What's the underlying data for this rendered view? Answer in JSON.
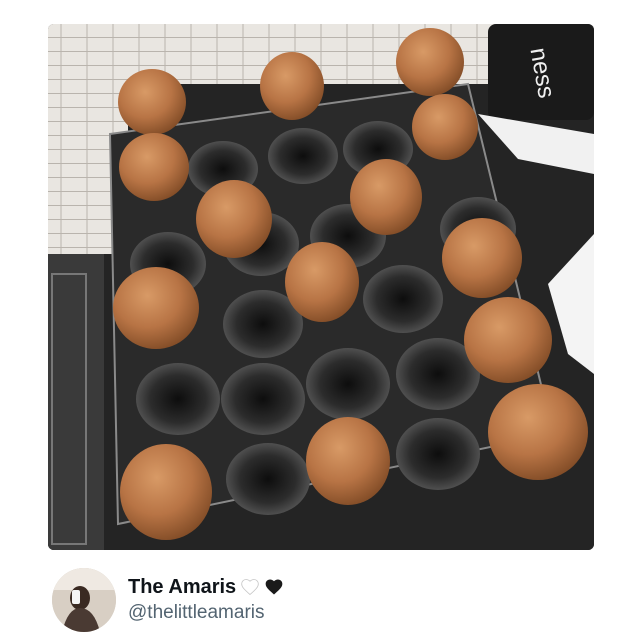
{
  "post": {
    "image_alt": "Brown eggs in a clear plastic egg tray",
    "cup_text": "ness"
  },
  "author": {
    "display_name": "The Amaris",
    "handle": "@thelittleamaris",
    "badges": [
      "white-heart-icon",
      "black-heart-icon"
    ]
  },
  "colors": {
    "egg": "#b87445",
    "egg_light": "#cf8c57",
    "tray_dark": "#1d1d1d",
    "name": "#0f1419",
    "handle": "#536471"
  }
}
